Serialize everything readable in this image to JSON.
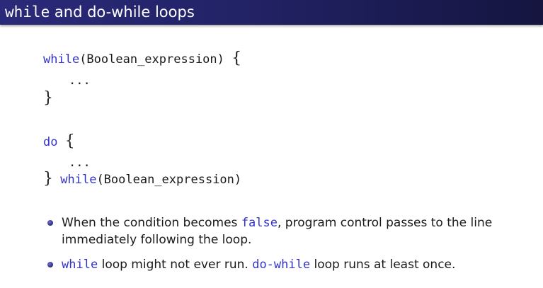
{
  "slide": {
    "title_code": "while",
    "title_rest": " and do-while loops"
  },
  "code_block_1": {
    "keyword": "while",
    "args": "(Boolean_expression) ",
    "open_brace": "{",
    "body": "...",
    "close_brace": "}"
  },
  "code_block_2": {
    "keyword": "do",
    "open_brace": "{",
    "body": "...",
    "close_brace": "}",
    "trailing_keyword": "while",
    "trailing_args": "(Boolean_expression)"
  },
  "bullets": [
    {
      "pre": "When the condition becomes ",
      "code": "false",
      "post": ", program control passes to the line immediately following the loop."
    },
    {
      "code1": "while",
      "mid": " loop might not ever run. ",
      "code2": "do-while",
      "post": " loop runs at least once."
    }
  ],
  "colors": {
    "title_bar": "#222266",
    "keyword": "#3333cc",
    "bullet": "#2a2a7a"
  }
}
